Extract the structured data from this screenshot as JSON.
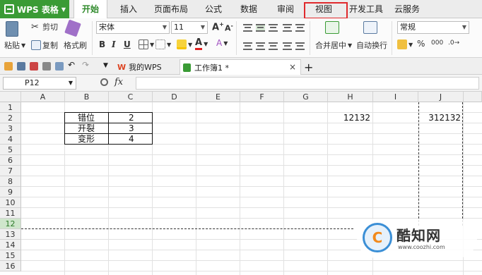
{
  "menubar": {
    "app_name": "WPS 表格",
    "tabs": [
      "开始",
      "插入",
      "页面布局",
      "公式",
      "数据",
      "审阅",
      "视图",
      "开发工具",
      "云服务"
    ],
    "active_tab": "开始",
    "highlighted_tab": "视图"
  },
  "ribbon": {
    "paste": "粘贴",
    "cut": "剪切",
    "copy": "复制",
    "format_painter": "格式刷",
    "font_name": "宋体",
    "font_size": "11",
    "merge_center": "合并居中",
    "wrap_text": "自动换行",
    "number_format": "常规",
    "percent": "%",
    "thousands": "000",
    "increase_font": "A",
    "decrease_font": "A",
    "bold": "B",
    "italic": "I",
    "underline": "U",
    "font_color": "A",
    "clear": "A"
  },
  "quickbar": {
    "tabs": [
      {
        "label": "我的WPS",
        "active": false
      },
      {
        "label": "工作簿1 *",
        "active": true
      }
    ],
    "close": "×",
    "add": "+"
  },
  "formulabar": {
    "cell_ref": "P12",
    "fx": "fx",
    "content": ""
  },
  "grid": {
    "columns": [
      "A",
      "B",
      "C",
      "D",
      "E",
      "F",
      "G",
      "H",
      "I",
      "J"
    ],
    "rows": [
      "1",
      "2",
      "3",
      "4",
      "5",
      "6",
      "7",
      "8",
      "9",
      "10",
      "11",
      "12",
      "13",
      "14",
      "15",
      "16"
    ],
    "selected_row": "12",
    "cells": {
      "B2": "错位",
      "C2": "2",
      "B3": "开裂",
      "C3": "3",
      "B4": "变形",
      "C4": "4",
      "H2": "12132",
      "J2": "312132"
    }
  },
  "watermark": {
    "title": "酷知网",
    "url": "www.coozhi.com",
    "logo_letter": "C"
  },
  "colors": {
    "app_green": "#3a9b35",
    "highlight_red": "#e0292c",
    "selected_row_bg": "#cfe6cc"
  }
}
